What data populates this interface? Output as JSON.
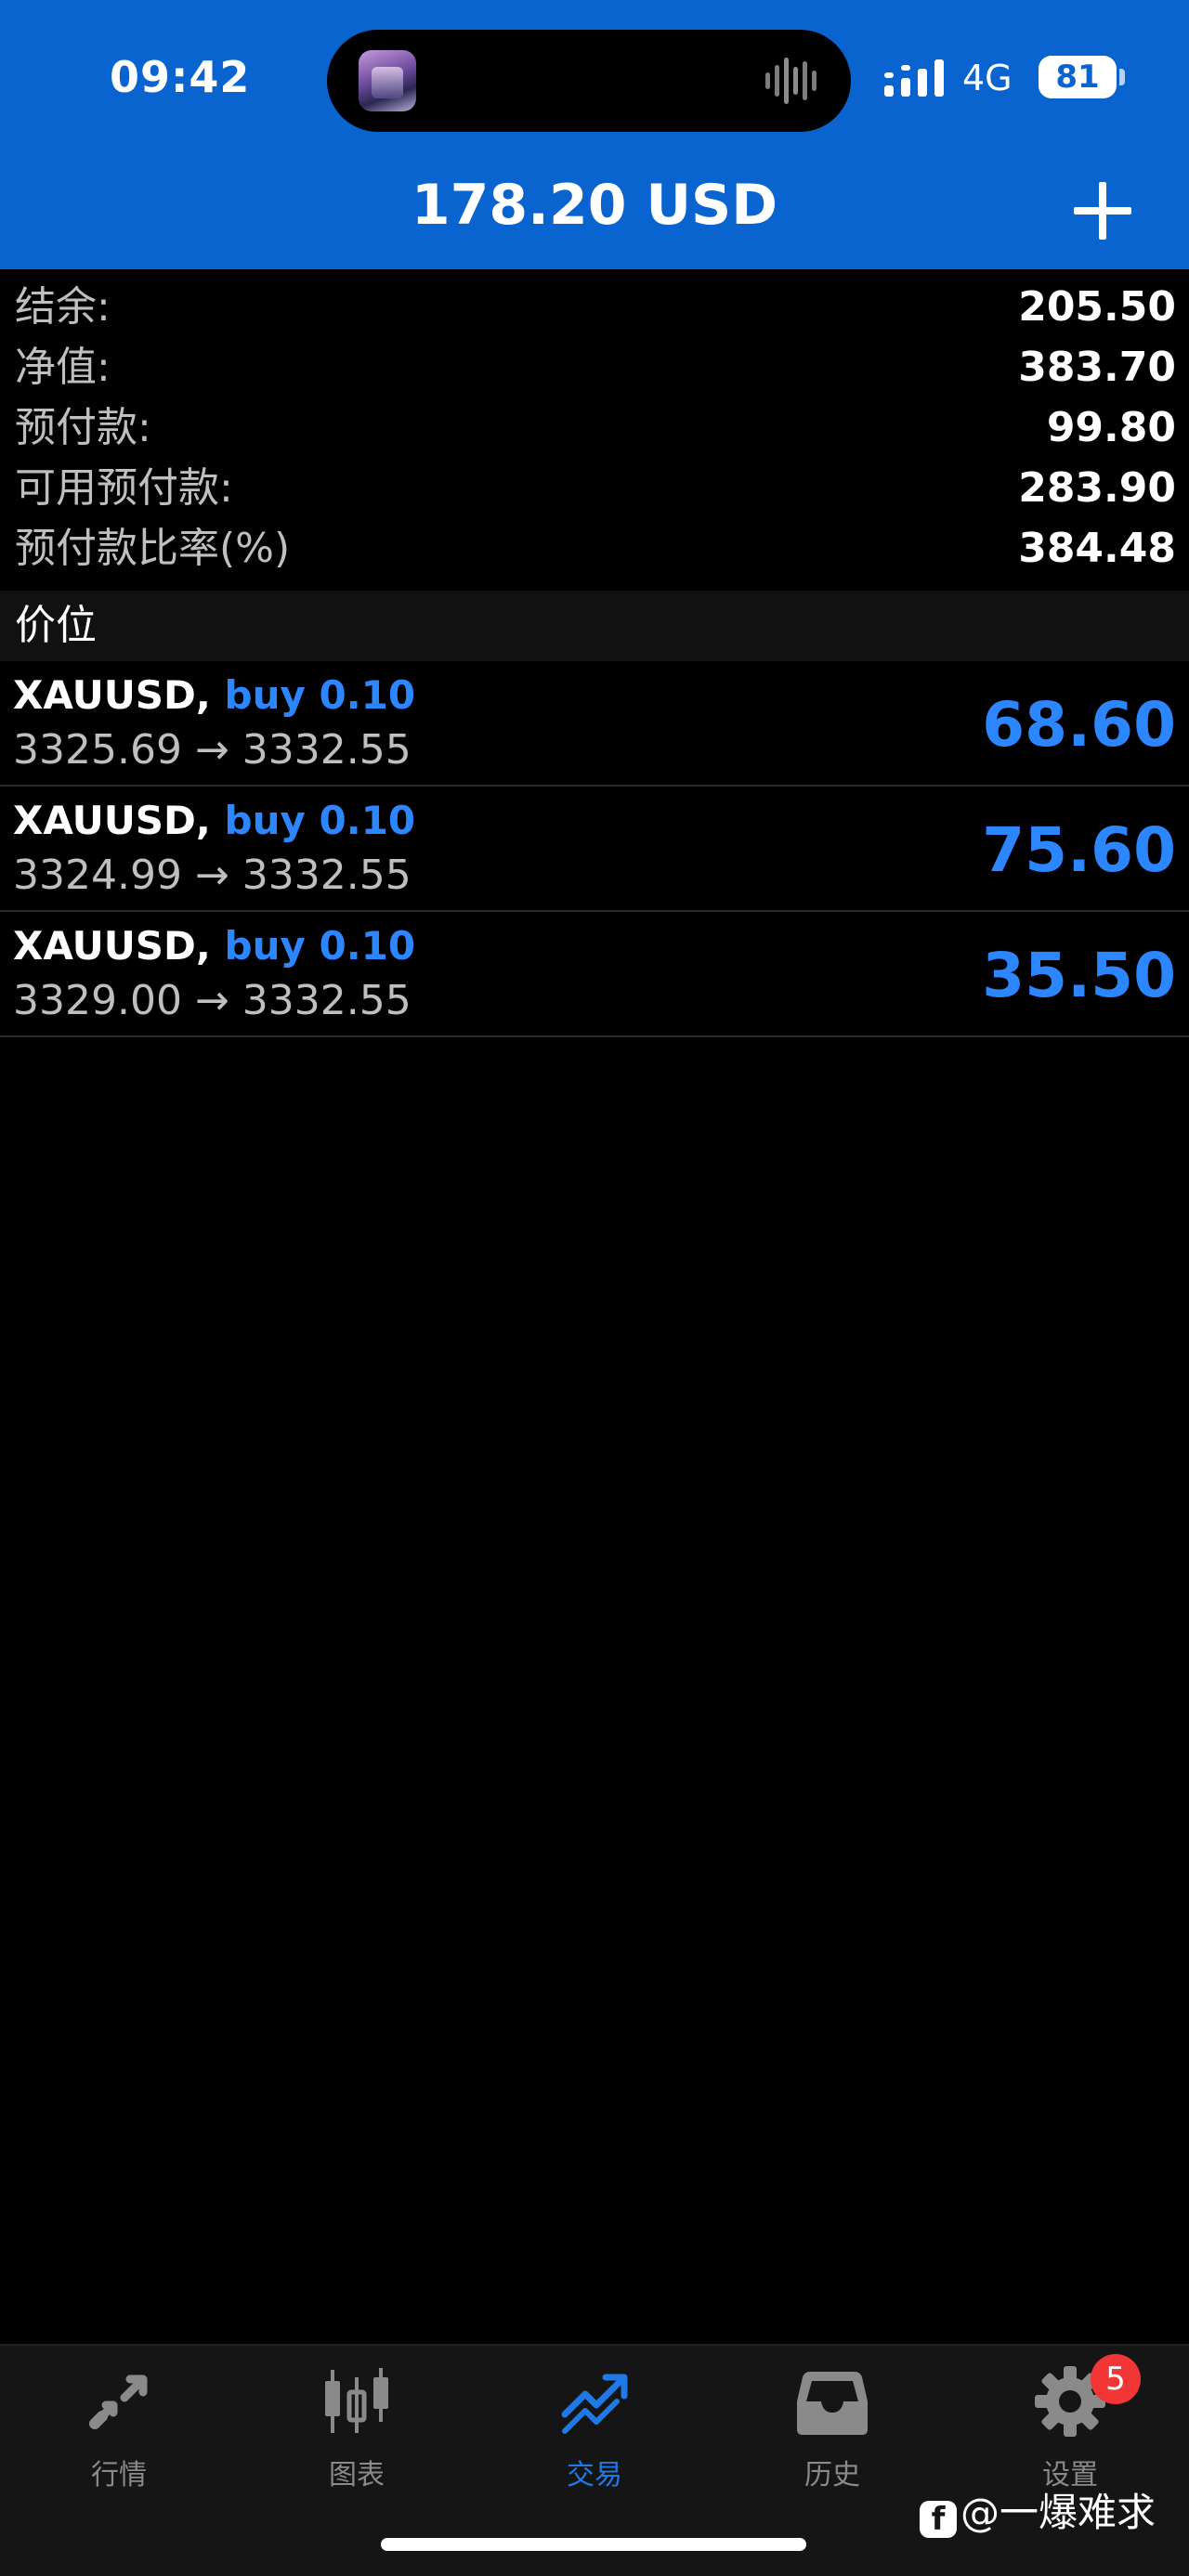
{
  "status_bar": {
    "time": "09:42",
    "network": "4G",
    "battery": "81",
    "battery_level": 0.81
  },
  "header": {
    "title": "178.20 USD",
    "add_icon": "plus-icon"
  },
  "summary": [
    {
      "label": "结余:",
      "value": "205.50"
    },
    {
      "label": "净值:",
      "value": "383.70"
    },
    {
      "label": "预付款:",
      "value": "99.80"
    },
    {
      "label": "可用预付款:",
      "value": "283.90"
    },
    {
      "label": "预付款比率(%)",
      "value": "384.48"
    }
  ],
  "positions": {
    "title": "价位",
    "items": [
      {
        "symbol": "XAUUSD,",
        "side": "buy 0.10",
        "prices": "3325.69 → 3332.55",
        "profit": "68.60"
      },
      {
        "symbol": "XAUUSD,",
        "side": "buy 0.10",
        "prices": "3324.99 → 3332.55",
        "profit": "75.60"
      },
      {
        "symbol": "XAUUSD,",
        "side": "buy 0.10",
        "prices": "3329.00 → 3332.55",
        "profit": "35.50"
      }
    ]
  },
  "tabs": [
    {
      "label": "行情",
      "icon": "quotes-icon",
      "active": false
    },
    {
      "label": "图表",
      "icon": "candlestick-chart-icon",
      "active": false
    },
    {
      "label": "交易",
      "icon": "trade-icon",
      "active": true
    },
    {
      "label": "历史",
      "icon": "history-tray-icon",
      "active": false
    },
    {
      "label": "设置",
      "icon": "gear-icon",
      "active": false
    }
  ],
  "settings_badge": "5",
  "watermark": "@一爆难求",
  "colors": {
    "header_bg": "#0a64d0",
    "accent_blue": "#2c86ff",
    "active_tab": "#1f7ae8",
    "badge_red": "#f23535",
    "background": "#000000"
  }
}
